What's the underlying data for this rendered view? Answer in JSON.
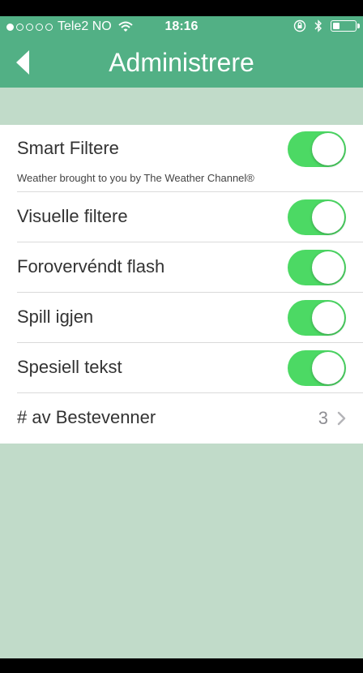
{
  "status_bar": {
    "carrier": "Tele2 NO",
    "time": "18:16",
    "signal_dots_filled": 1,
    "signal_dots_total": 5,
    "battery_level": 0.3,
    "icons": [
      "wifi-icon",
      "rotation-lock-icon",
      "bluetooth-icon",
      "battery-icon"
    ]
  },
  "nav": {
    "title": "Administrere",
    "back_icon": "back-arrow-icon"
  },
  "settings": [
    {
      "label": "Smart Filtere",
      "sublabel": "Weather brought to you by The Weather Channel®",
      "type": "toggle",
      "on": true
    },
    {
      "label": "Visuelle filtere",
      "type": "toggle",
      "on": true
    },
    {
      "label": "Forovervéndt flash",
      "type": "toggle",
      "on": true
    },
    {
      "label": "Spill igjen",
      "type": "toggle",
      "on": true
    },
    {
      "label": "Spesiell tekst",
      "type": "toggle",
      "on": true
    },
    {
      "label": "# av Bestevenner",
      "type": "disclosure",
      "value": "3"
    }
  ],
  "colors": {
    "header": "#52b085",
    "background": "#c1dbc9",
    "toggle_on": "#4cd964"
  }
}
